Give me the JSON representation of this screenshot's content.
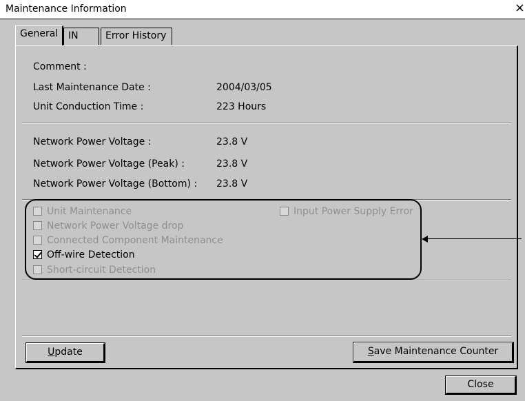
{
  "window": {
    "title": "Maintenance Information",
    "close_glyph": "×"
  },
  "tabs": [
    {
      "label": "General"
    },
    {
      "label": "IN"
    },
    {
      "label": "Error History"
    }
  ],
  "general": {
    "comment_label": "Comment :",
    "last_maint_label": "Last Maintenance Date :",
    "last_maint_value": "2004/03/05",
    "conduction_label": "Unit Conduction Time :",
    "conduction_value": "223 Hours",
    "voltage_label": "Network Power Voltage :",
    "voltage_value": "23.8 V",
    "voltage_peak_label": "Network Power Voltage (Peak) :",
    "voltage_peak_value": "23.8 V",
    "voltage_bottom_label": "Network Power Voltage (Bottom) :",
    "voltage_bottom_value": "23.8 V"
  },
  "checks": {
    "unit_maintenance": {
      "label": "Unit Maintenance",
      "checked": false,
      "enabled": false
    },
    "voltage_drop": {
      "label": "Network Power Voltage drop",
      "checked": false,
      "enabled": false
    },
    "connected_component": {
      "label": "Connected Component Maintenance",
      "checked": false,
      "enabled": false
    },
    "off_wire": {
      "label": "Off-wire Detection",
      "checked": true,
      "enabled": true
    },
    "short_circuit": {
      "label": "Short-circuit Detection",
      "checked": false,
      "enabled": false
    },
    "input_power": {
      "label": "Input Power Supply Error",
      "checked": false,
      "enabled": false
    }
  },
  "buttons": {
    "update_prefix": "",
    "update_mnemonic": "U",
    "update_rest": "pdate",
    "save_mnemonic": "S",
    "save_rest": "ave Maintenance Counter",
    "close": "Close"
  },
  "colors": {
    "dialog_bg": "#c6c6c6",
    "disabled_text": "#8f8f8f"
  }
}
